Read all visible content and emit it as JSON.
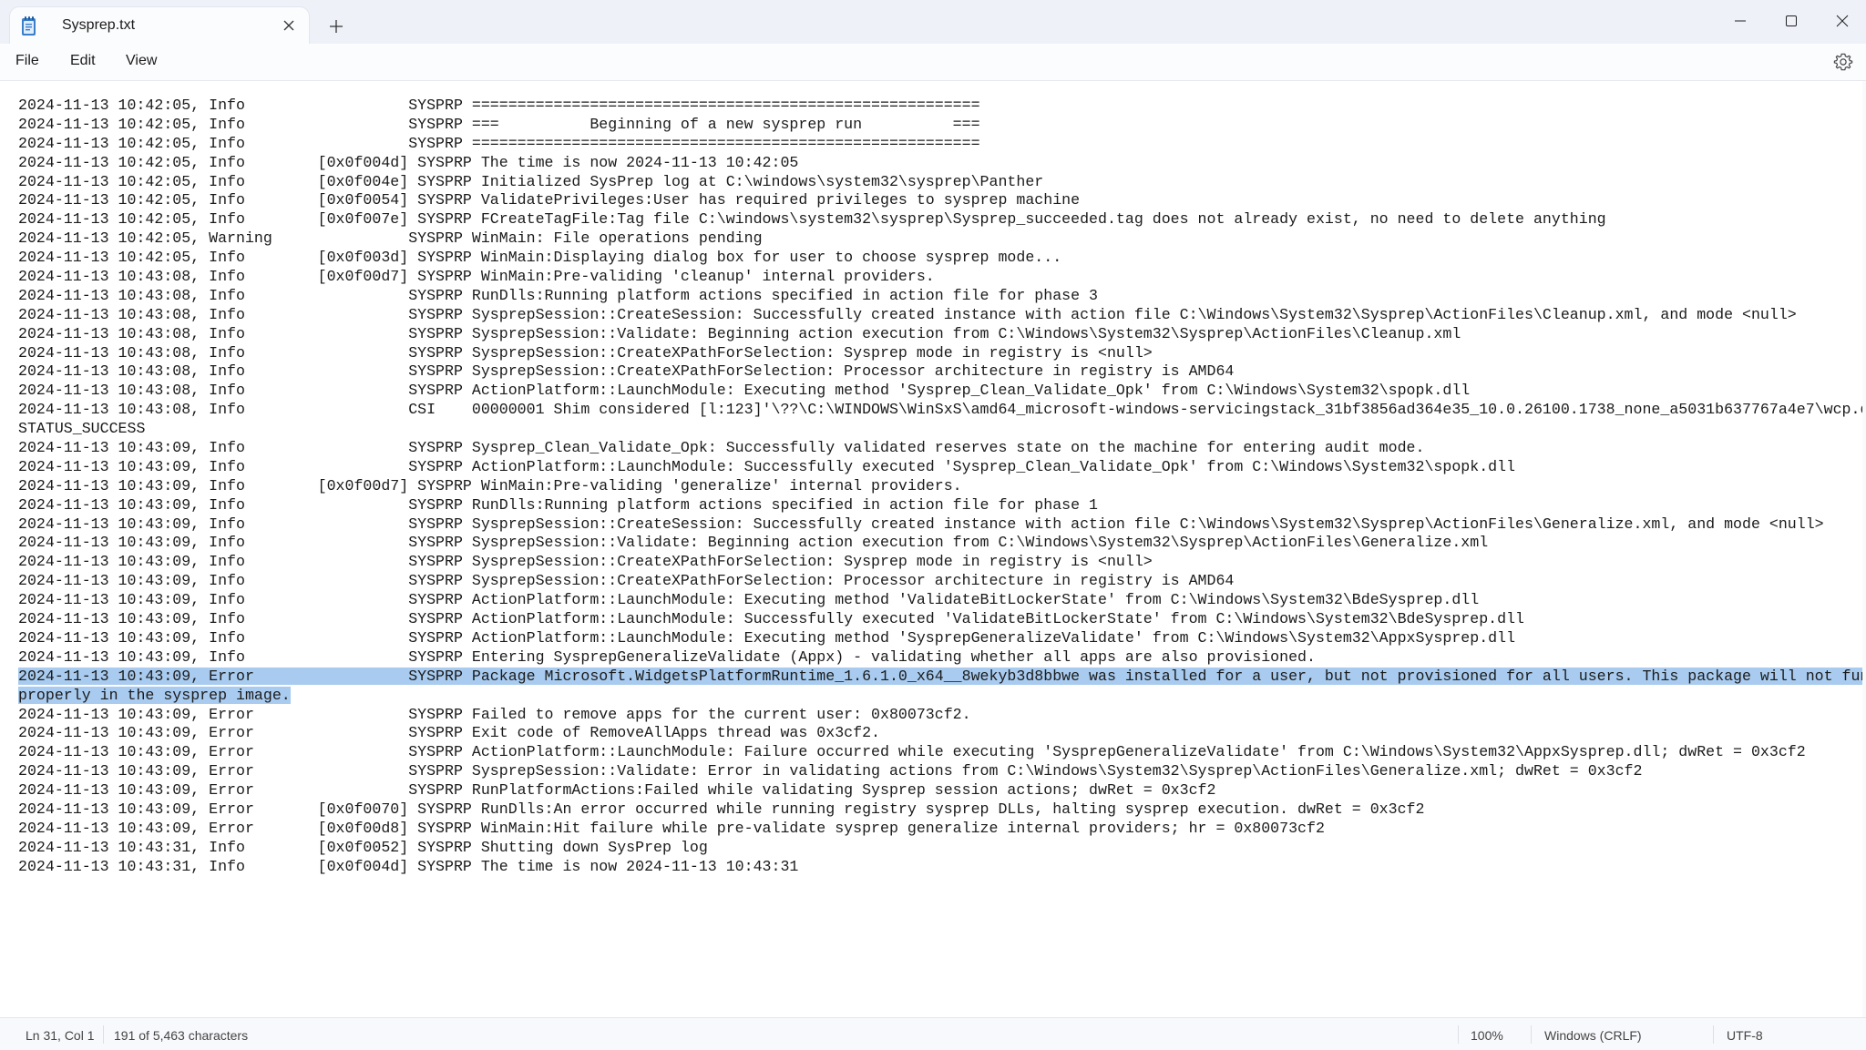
{
  "window": {
    "tab_title": "Sysprep.txt",
    "icons": {
      "app": "notepad-icon",
      "close_tab": "close-icon",
      "new_tab": "plus-icon",
      "minimize": "minimize-icon",
      "maximize": "maximize-icon",
      "close": "close-icon"
    }
  },
  "menu": {
    "file": "File",
    "edit": "Edit",
    "view": "View",
    "settings_icon": "gear-icon"
  },
  "editor": {
    "selection_color": "#a8cbef",
    "selected_line_indices": [
      30,
      31
    ],
    "lines": [
      "2024-11-13 10:42:05, Info                  SYSPRP ========================================================",
      "2024-11-13 10:42:05, Info                  SYSPRP ===          Beginning of a new sysprep run          ===",
      "2024-11-13 10:42:05, Info                  SYSPRP ========================================================",
      "2024-11-13 10:42:05, Info        [0x0f004d] SYSPRP The time is now 2024-11-13 10:42:05",
      "2024-11-13 10:42:05, Info        [0x0f004e] SYSPRP Initialized SysPrep log at C:\\windows\\system32\\sysprep\\Panther",
      "2024-11-13 10:42:05, Info        [0x0f0054] SYSPRP ValidatePrivileges:User has required privileges to sysprep machine",
      "2024-11-13 10:42:05, Info        [0x0f007e] SYSPRP FCreateTagFile:Tag file C:\\windows\\system32\\sysprep\\Sysprep_succeeded.tag does not already exist, no need to delete anything",
      "2024-11-13 10:42:05, Warning               SYSPRP WinMain: File operations pending",
      "2024-11-13 10:42:05, Info        [0x0f003d] SYSPRP WinMain:Displaying dialog box for user to choose sysprep mode...",
      "2024-11-13 10:43:08, Info        [0x0f00d7] SYSPRP WinMain:Pre-validing 'cleanup' internal providers.",
      "2024-11-13 10:43:08, Info                  SYSPRP RunDlls:Running platform actions specified in action file for phase 3",
      "2024-11-13 10:43:08, Info                  SYSPRP SysprepSession::CreateSession: Successfully created instance with action file C:\\Windows\\System32\\Sysprep\\ActionFiles\\Cleanup.xml, and mode <null>",
      "2024-11-13 10:43:08, Info                  SYSPRP SysprepSession::Validate: Beginning action execution from C:\\Windows\\System32\\Sysprep\\ActionFiles\\Cleanup.xml",
      "2024-11-13 10:43:08, Info                  SYSPRP SysprepSession::CreateXPathForSelection: Sysprep mode in registry is <null>",
      "2024-11-13 10:43:08, Info                  SYSPRP SysprepSession::CreateXPathForSelection: Processor architecture in registry is AMD64",
      "2024-11-13 10:43:08, Info                  SYSPRP ActionPlatform::LaunchModule: Executing method 'Sysprep_Clean_Validate_Opk' from C:\\Windows\\System32\\spopk.dll",
      "2024-11-13 10:43:08, Info                  CSI    00000001 Shim considered [l:123]'\\??\\C:\\WINDOWS\\WinSxS\\amd64_microsoft-windows-servicingstack_31bf3856ad364e35_10.0.26100.1738_none_a5031b637767a4e7\\wcp.dll' : got",
      "STATUS_SUCCESS",
      "2024-11-13 10:43:09, Info                  SYSPRP Sysprep_Clean_Validate_Opk: Successfully validated reserves state on the machine for entering audit mode.",
      "2024-11-13 10:43:09, Info                  SYSPRP ActionPlatform::LaunchModule: Successfully executed 'Sysprep_Clean_Validate_Opk' from C:\\Windows\\System32\\spopk.dll",
      "2024-11-13 10:43:09, Info        [0x0f00d7] SYSPRP WinMain:Pre-validing 'generalize' internal providers.",
      "2024-11-13 10:43:09, Info                  SYSPRP RunDlls:Running platform actions specified in action file for phase 1",
      "2024-11-13 10:43:09, Info                  SYSPRP SysprepSession::CreateSession: Successfully created instance with action file C:\\Windows\\System32\\Sysprep\\ActionFiles\\Generalize.xml, and mode <null>",
      "2024-11-13 10:43:09, Info                  SYSPRP SysprepSession::Validate: Beginning action execution from C:\\Windows\\System32\\Sysprep\\ActionFiles\\Generalize.xml",
      "2024-11-13 10:43:09, Info                  SYSPRP SysprepSession::CreateXPathForSelection: Sysprep mode in registry is <null>",
      "2024-11-13 10:43:09, Info                  SYSPRP SysprepSession::CreateXPathForSelection: Processor architecture in registry is AMD64",
      "2024-11-13 10:43:09, Info                  SYSPRP ActionPlatform::LaunchModule: Executing method 'ValidateBitLockerState' from C:\\Windows\\System32\\BdeSysprep.dll",
      "2024-11-13 10:43:09, Info                  SYSPRP ActionPlatform::LaunchModule: Successfully executed 'ValidateBitLockerState' from C:\\Windows\\System32\\BdeSysprep.dll",
      "2024-11-13 10:43:09, Info                  SYSPRP ActionPlatform::LaunchModule: Executing method 'SysprepGeneralizeValidate' from C:\\Windows\\System32\\AppxSysprep.dll",
      "2024-11-13 10:43:09, Info                  SYSPRP Entering SysprepGeneralizeValidate (Appx) - validating whether all apps are also provisioned.",
      "2024-11-13 10:43:09, Error                 SYSPRP Package Microsoft.WidgetsPlatformRuntime_1.6.1.0_x64__8wekyb3d8bbwe was installed for a user, but not provisioned for all users. This package will not function",
      "properly in the sysprep image.",
      "2024-11-13 10:43:09, Error                 SYSPRP Failed to remove apps for the current user: 0x80073cf2.",
      "2024-11-13 10:43:09, Error                 SYSPRP Exit code of RemoveAllApps thread was 0x3cf2.",
      "2024-11-13 10:43:09, Error                 SYSPRP ActionPlatform::LaunchModule: Failure occurred while executing 'SysprepGeneralizeValidate' from C:\\Windows\\System32\\AppxSysprep.dll; dwRet = 0x3cf2",
      "2024-11-13 10:43:09, Error                 SYSPRP SysprepSession::Validate: Error in validating actions from C:\\Windows\\System32\\Sysprep\\ActionFiles\\Generalize.xml; dwRet = 0x3cf2",
      "2024-11-13 10:43:09, Error                 SYSPRP RunPlatformActions:Failed while validating Sysprep session actions; dwRet = 0x3cf2",
      "2024-11-13 10:43:09, Error       [0x0f0070] SYSPRP RunDlls:An error occurred while running registry sysprep DLLs, halting sysprep execution. dwRet = 0x3cf2",
      "2024-11-13 10:43:09, Error       [0x0f00d8] SYSPRP WinMain:Hit failure while pre-validate sysprep generalize internal providers; hr = 0x80073cf2",
      "2024-11-13 10:43:31, Info        [0x0f0052] SYSPRP Shutting down SysPrep log",
      "2024-11-13 10:43:31, Info        [0x0f004d] SYSPRP The time is now 2024-11-13 10:43:31"
    ]
  },
  "status": {
    "position": "Ln 31, Col 1",
    "selection": "191 of 5,463 characters",
    "zoom": "100%",
    "line_ending": "Windows (CRLF)",
    "encoding": "UTF-8"
  }
}
